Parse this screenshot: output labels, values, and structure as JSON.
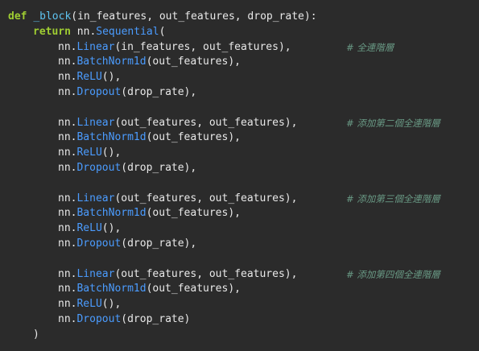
{
  "code": {
    "def_kw": "def",
    "func_name": "_block",
    "func_params": "(in_features, out_features, drop_rate):",
    "return_kw": "return",
    "nn_prefix": "nn.",
    "sequential": "Sequential",
    "sequential_open": "(",
    "linear": "Linear",
    "batchnorm": "BatchNorm1d",
    "relu": "ReLU",
    "dropout": "Dropout",
    "linear_args_1": "(in_features, out_features),",
    "linear_args_n": "(out_features, out_features),",
    "batchnorm_args": "(out_features),",
    "relu_args": "(),",
    "dropout_args": "(drop_rate),",
    "dropout_args_last": "(drop_rate)",
    "close_paren": ")",
    "comment_1": "# 全連階層",
    "comment_2": "# 添加第二個全連階層",
    "comment_3": "# 添加第三個全連階層",
    "comment_4": "# 添加第四個全連階層"
  }
}
